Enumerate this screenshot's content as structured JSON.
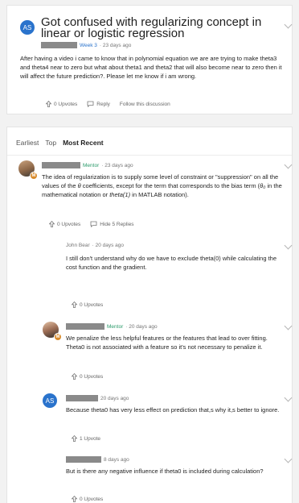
{
  "thread": {
    "title": "Got confused with regularizing concept in linear or logistic regression",
    "avatar_initials": "AS",
    "week_label": "Week 3",
    "time": "· 23 days ago",
    "body": "After having a video i came to know that in polynomial equation we are are trying to make theta3 and theta4 near to zero but what about theta1 and theta2 that will also become near to zero then it will affect the future prediction?. Please let me know if i am wrong.",
    "upvotes": "0 Upvotes",
    "reply": "Reply",
    "follow": "Follow this discussion"
  },
  "sort": {
    "earliest": "Earliest",
    "top": "Top",
    "recent": "Most Recent"
  },
  "comments": [
    {
      "role": "Mentor",
      "time": "· 23 days ago",
      "badge": "M",
      "body_a": "The idea of regularization is to supply some level of constraint or \"suppression\" on all the values of the ",
      "theta": "θ",
      "body_b": " coefficients, except for the term that corresponds to the bias term (",
      "theta0": "θ₀",
      "body_c": " in the mathematical notation or ",
      "theta1": "theta(1)",
      "body_d": " in MATLAB notation).",
      "upvotes": "0 Upvotes",
      "hide": "Hide 5 Replies"
    },
    {
      "author": "John Bear",
      "time": "· 20 days ago",
      "body": "I still don't understand why do we have to exclude theta(0) while calculating the cost function and the gradient.",
      "upvotes": "0 Upvotes"
    },
    {
      "role": "Mentor",
      "time": "· 20 days ago",
      "badge": "M",
      "body": "We penalize the less helpful features or the features that lead to over fitting. Theta0 is not associated with a feature so it's not necessary to penalize it.",
      "upvotes": "0 Upvotes"
    },
    {
      "avatar_initials": "AS",
      "time": "20 days ago",
      "body": "Because theta0 has very less effect on prediction that,s why it,s better to ignore.",
      "upvotes": "1 Upvote"
    },
    {
      "time": "8 days ago",
      "body": "But is there any negative influence if theta0 is included during calculation?",
      "upvotes": "0 Upvotes"
    }
  ]
}
